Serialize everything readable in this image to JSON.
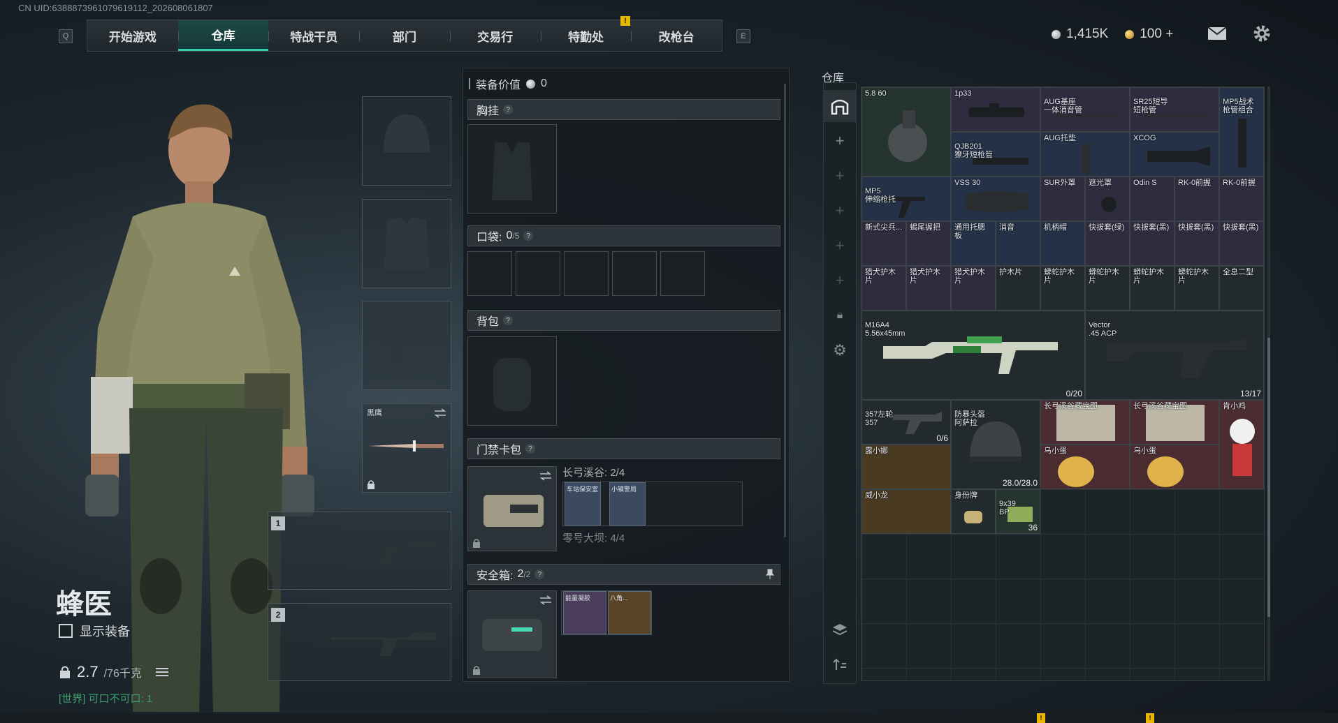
{
  "uid": "CN UID:638887396107961911​2_202608061807",
  "nav": {
    "left_key": "Q",
    "right_key": "E",
    "tabs": [
      "开始游戏",
      "仓库",
      "特战干员",
      "部门",
      "交易行",
      "特勤处",
      "改枪台"
    ],
    "active_index": 1,
    "alert": "!"
  },
  "currency": {
    "silver": "1,415K",
    "gold": "100 +"
  },
  "character": {
    "name": "蜂医",
    "show_equip_label": "显示装备",
    "weight_value": "2.7",
    "weight_max": "/76千克",
    "world_chat": "[世界] 可口不可口: 1"
  },
  "slots": {
    "melee_label": "黑鹰",
    "primary_num": "1",
    "secondary_num": "2"
  },
  "equip_panel": {
    "value_label": "装备价值",
    "value": "0",
    "chest_rig": "胸挂",
    "pockets_label": "口袋:",
    "pockets_count": "0",
    "pockets_max": "/5",
    "backpack": "背包",
    "keycard_label": "门禁卡包",
    "keycard_map1": "长弓溪谷: 2/4",
    "keycard_item1": "车站保安室",
    "keycard_item2": "小镇警局",
    "keycard_map2": "零号大坝: 4/4",
    "safe_label": "安全箱:",
    "safe_count": "2",
    "safe_max": "/2",
    "safe_item1": "能量凝胶",
    "safe_item2": "八角..."
  },
  "warehouse": {
    "title": "仓库",
    "items": [
      {
        "label": "5.8 60"
      },
      {
        "label": "1p33"
      },
      {
        "label": "AUG基座\n一体消音管"
      },
      {
        "label": "SR25短导\n短枪管"
      },
      {
        "label": "MP5战术\n枪管组合"
      },
      {
        "label": "QJB201\n獠牙短枪管"
      },
      {
        "label": "AUG托垫"
      },
      {
        "label": "XCOG"
      },
      {
        "label": "MP5\n伸缩枪托"
      },
      {
        "label": "VSS 30"
      },
      {
        "label": "SUR外罩"
      },
      {
        "label": "遮光罩"
      },
      {
        "label": "Odin S"
      },
      {
        "label": "RK-0前握"
      },
      {
        "label": "RK-0前握"
      },
      {
        "label": "新式尖兵..."
      },
      {
        "label": "蝎尾握把"
      },
      {
        "label": "通用托腮板"
      },
      {
        "label": "消音"
      },
      {
        "label": "机柄帽"
      },
      {
        "label": "快拔套(绿)"
      },
      {
        "label": "快拔套(黑)"
      },
      {
        "label": "快拔套(黑)"
      },
      {
        "label": "快拔套(黑)"
      },
      {
        "label": "猎犬护木片"
      },
      {
        "label": "猎犬护木片"
      },
      {
        "label": "猎犬护木片"
      },
      {
        "label": "护木片"
      },
      {
        "label": "蟒蛇护木片"
      },
      {
        "label": "蟒蛇护木片"
      },
      {
        "label": "蟒蛇护木片"
      },
      {
        "label": "蟒蛇护木片"
      },
      {
        "label": "全息二型"
      },
      {
        "label": "M16A4\n5.56x45mm",
        "count": "0/20"
      },
      {
        "label": "Vector\n.45 ACP",
        "count": "13/17"
      },
      {
        "label": "357左轮\n357",
        "count": "0/6"
      },
      {
        "label": "防暴头盔\n阿萨拉",
        "count": "28.0/28.0"
      },
      {
        "label": "长弓溪谷藏宝图"
      },
      {
        "label": "长弓溪谷藏宝图"
      },
      {
        "label": "肯小鸡"
      },
      {
        "label": "露小娜"
      },
      {
        "label": "乌小蛋"
      },
      {
        "label": "乌小蛋"
      },
      {
        "label": "威小龙"
      },
      {
        "label": "身份牌"
      },
      {
        "label": "9x39\nBP",
        "count": "36"
      }
    ]
  }
}
